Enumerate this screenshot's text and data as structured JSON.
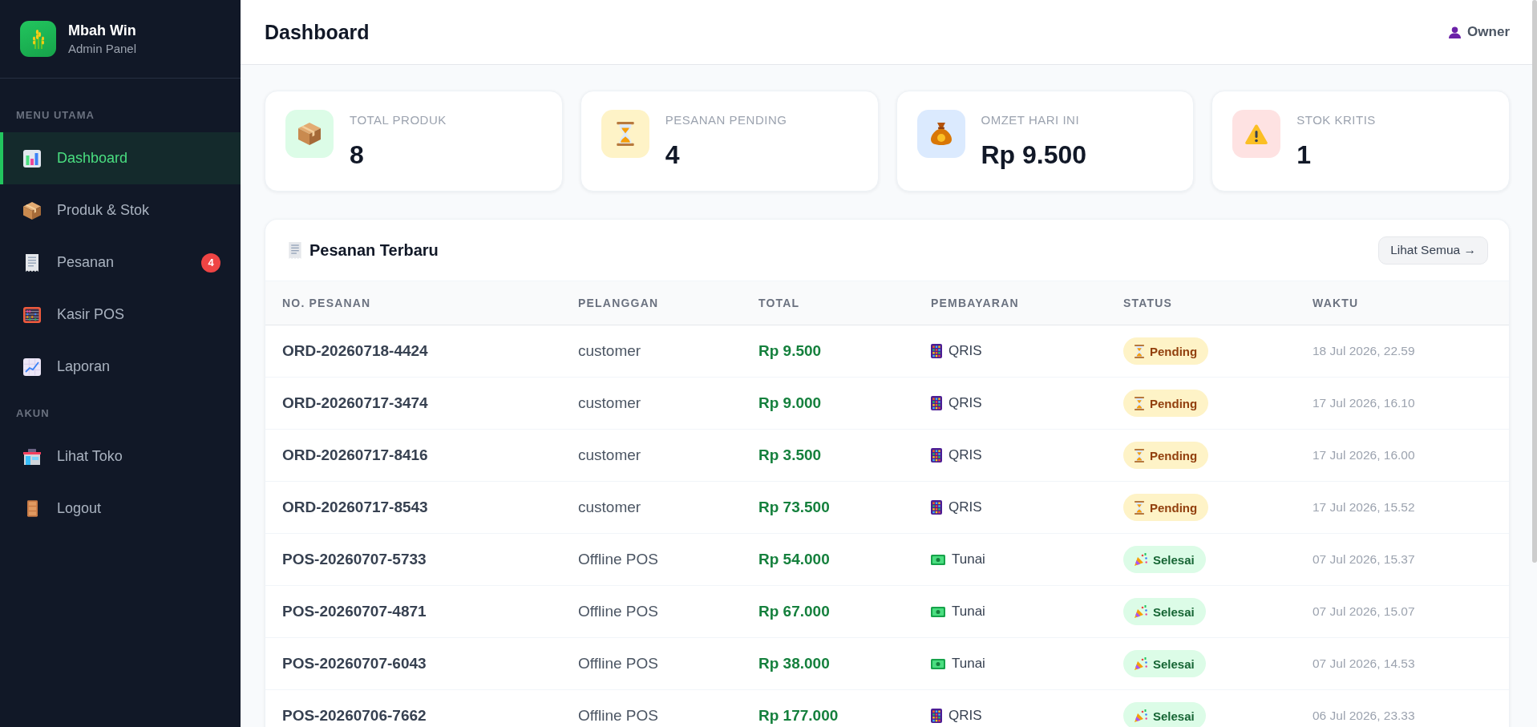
{
  "sidebar": {
    "brand": {
      "name": "Mbah Win",
      "subtitle": "Admin Panel"
    },
    "sections": [
      {
        "title": "MENU UTAMA",
        "items": [
          {
            "label": "Dashboard",
            "selected": true
          },
          {
            "label": "Produk & Stok",
            "selected": false
          },
          {
            "label": "Pesanan",
            "selected": false,
            "badge": "4"
          },
          {
            "label": "Kasir POS",
            "selected": false
          },
          {
            "label": "Laporan",
            "selected": false
          }
        ]
      },
      {
        "title": "AKUN",
        "items": [
          {
            "label": "Lihat Toko",
            "selected": false
          },
          {
            "label": "Logout",
            "selected": false
          }
        ]
      }
    ]
  },
  "header": {
    "title": "Dashboard",
    "user": "Owner"
  },
  "stats": [
    {
      "label": "TOTAL PRODUK",
      "value": "8"
    },
    {
      "label": "PESANAN PENDING",
      "value": "4"
    },
    {
      "label": "OMZET HARI INI",
      "value": "Rp 9.500"
    },
    {
      "label": "STOK KRITIS",
      "value": "1"
    }
  ],
  "orders": {
    "title": "Pesanan Terbaru",
    "action": "Lihat Semua →",
    "columns": [
      "NO. PESANAN",
      "PELANGGAN",
      "TOTAL",
      "PEMBAYARAN",
      "STATUS",
      "WAKTU"
    ],
    "rows": [
      {
        "order_no": "ORD-20260718-4424",
        "customer": "customer",
        "total": "Rp 9.500",
        "payment": {
          "label": "QRIS",
          "kind": "qris"
        },
        "status": {
          "label": "Pending",
          "kind": "pending"
        },
        "time": "18 Jul 2026, 22.59"
      },
      {
        "order_no": "ORD-20260717-3474",
        "customer": "customer",
        "total": "Rp 9.000",
        "payment": {
          "label": "QRIS",
          "kind": "qris"
        },
        "status": {
          "label": "Pending",
          "kind": "pending"
        },
        "time": "17 Jul 2026, 16.10"
      },
      {
        "order_no": "ORD-20260717-8416",
        "customer": "customer",
        "total": "Rp 3.500",
        "payment": {
          "label": "QRIS",
          "kind": "qris"
        },
        "status": {
          "label": "Pending",
          "kind": "pending"
        },
        "time": "17 Jul 2026, 16.00"
      },
      {
        "order_no": "ORD-20260717-8543",
        "customer": "customer",
        "total": "Rp 73.500",
        "payment": {
          "label": "QRIS",
          "kind": "qris"
        },
        "status": {
          "label": "Pending",
          "kind": "pending"
        },
        "time": "17 Jul 2026, 15.52"
      },
      {
        "order_no": "POS-20260707-5733",
        "customer": "Offline POS",
        "total": "Rp 54.000",
        "payment": {
          "label": "Tunai",
          "kind": "cash"
        },
        "status": {
          "label": "Selesai",
          "kind": "done"
        },
        "time": "07 Jul 2026, 15.37"
      },
      {
        "order_no": "POS-20260707-4871",
        "customer": "Offline POS",
        "total": "Rp 67.000",
        "payment": {
          "label": "Tunai",
          "kind": "cash"
        },
        "status": {
          "label": "Selesai",
          "kind": "done"
        },
        "time": "07 Jul 2026, 15.07"
      },
      {
        "order_no": "POS-20260707-6043",
        "customer": "Offline POS",
        "total": "Rp 38.000",
        "payment": {
          "label": "Tunai",
          "kind": "cash"
        },
        "status": {
          "label": "Selesai",
          "kind": "done"
        },
        "time": "07 Jul 2026, 14.53"
      },
      {
        "order_no": "POS-20260706-7662",
        "customer": "Offline POS",
        "total": "Rp 177.000",
        "payment": {
          "label": "QRIS",
          "kind": "qris"
        },
        "status": {
          "label": "Selesai",
          "kind": "done"
        },
        "time": "06 Jul 2026, 23.33"
      }
    ]
  }
}
